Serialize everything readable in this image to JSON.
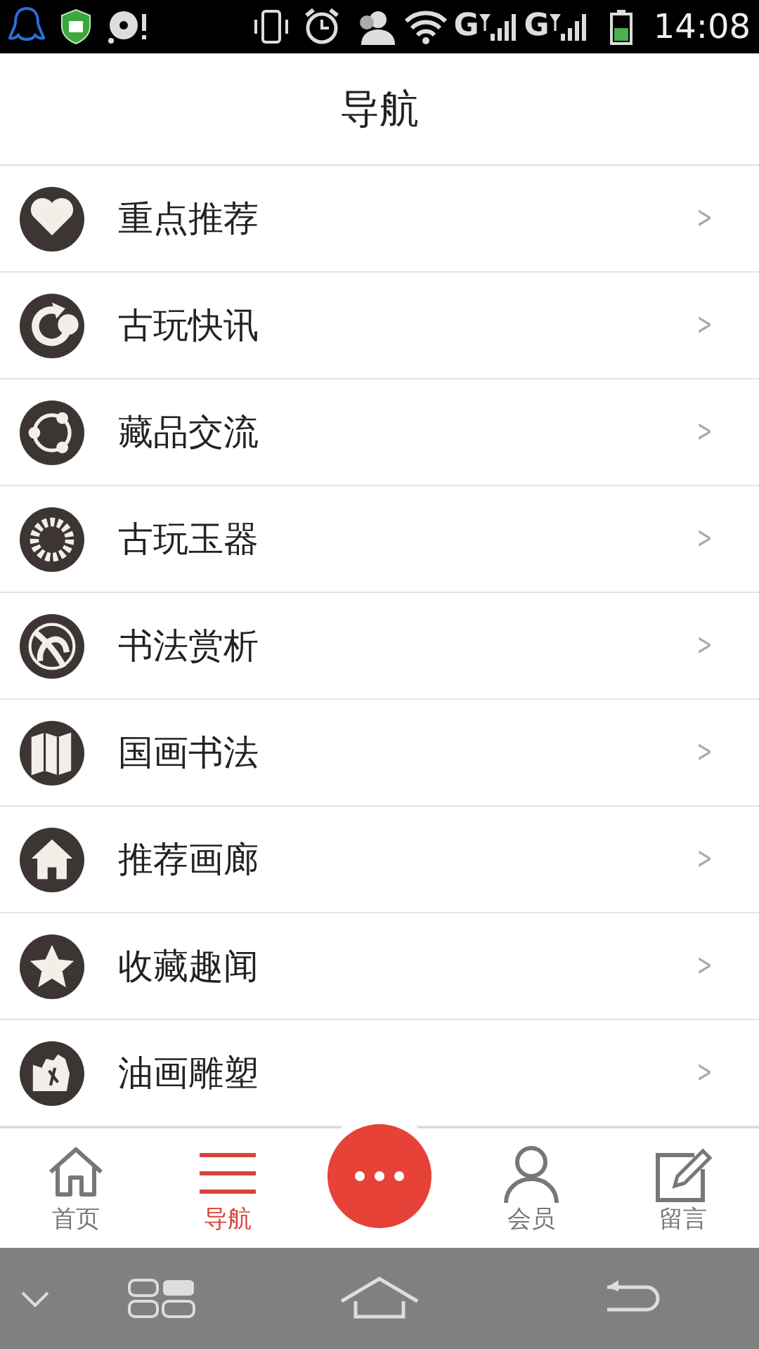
{
  "status_bar": {
    "networks": [
      {
        "label": "G"
      },
      {
        "label": "G"
      }
    ],
    "time": "14:08"
  },
  "header": {
    "title": "导航"
  },
  "menu": [
    {
      "label": "重点推荐",
      "chevron": ">"
    },
    {
      "label": "古玩快讯",
      "chevron": ">"
    },
    {
      "label": "藏品交流",
      "chevron": ">"
    },
    {
      "label": "古玩玉器",
      "chevron": ">"
    },
    {
      "label": "书法赏析",
      "chevron": ">"
    },
    {
      "label": "国画书法",
      "chevron": ">"
    },
    {
      "label": "推荐画廊",
      "chevron": ">"
    },
    {
      "label": "收藏趣闻",
      "chevron": ">"
    },
    {
      "label": "油画雕塑",
      "chevron": ">"
    }
  ],
  "tab_bar": [
    {
      "kind": "tab",
      "label": "首页",
      "selected": false
    },
    {
      "kind": "tab",
      "label": "导航",
      "selected": true
    },
    {
      "kind": "fab"
    },
    {
      "kind": "tab",
      "label": "会员",
      "selected": false
    },
    {
      "kind": "tab",
      "label": "留言",
      "selected": false
    }
  ]
}
